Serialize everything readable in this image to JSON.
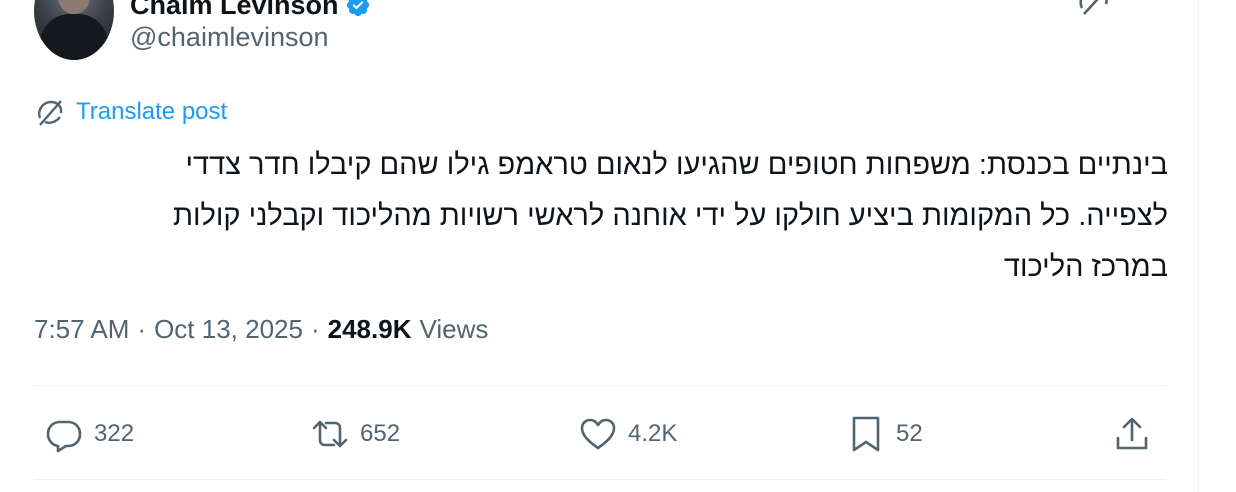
{
  "author": {
    "display_name": "Chaim Levinson",
    "handle": "@chaimlevinson"
  },
  "translate": {
    "label": "Translate post"
  },
  "tweet": {
    "text": "בינתיים בכנסת: משפחות חטופים שהגיעו לנאום טראמפ גילו שהם קיבלו חדר צדדי\nלצפייה. כל המקומות ביציע חולקו על ידי אוחנה לראשי רשויות מהליכוד וקבלני קולות\nבמרכז הליכוד"
  },
  "meta": {
    "time": "7:57 AM",
    "sep1": "·",
    "date": "Oct 13, 2025",
    "sep2": "·",
    "views_count": "248.9K",
    "views_label": "Views"
  },
  "actions": {
    "reply_count": "322",
    "repost_count": "652",
    "like_count": "4.2K",
    "bookmark_count": "52"
  },
  "colors": {
    "accent": "#1d9bf0",
    "text_primary": "#0f1419",
    "text_secondary": "#536471",
    "divider": "#eff3f4"
  },
  "icons": [
    "verified-badge-icon",
    "grok-icon",
    "more-icon",
    "translate-icon",
    "reply-icon",
    "repost-icon",
    "like-icon",
    "bookmark-icon",
    "share-icon"
  ]
}
